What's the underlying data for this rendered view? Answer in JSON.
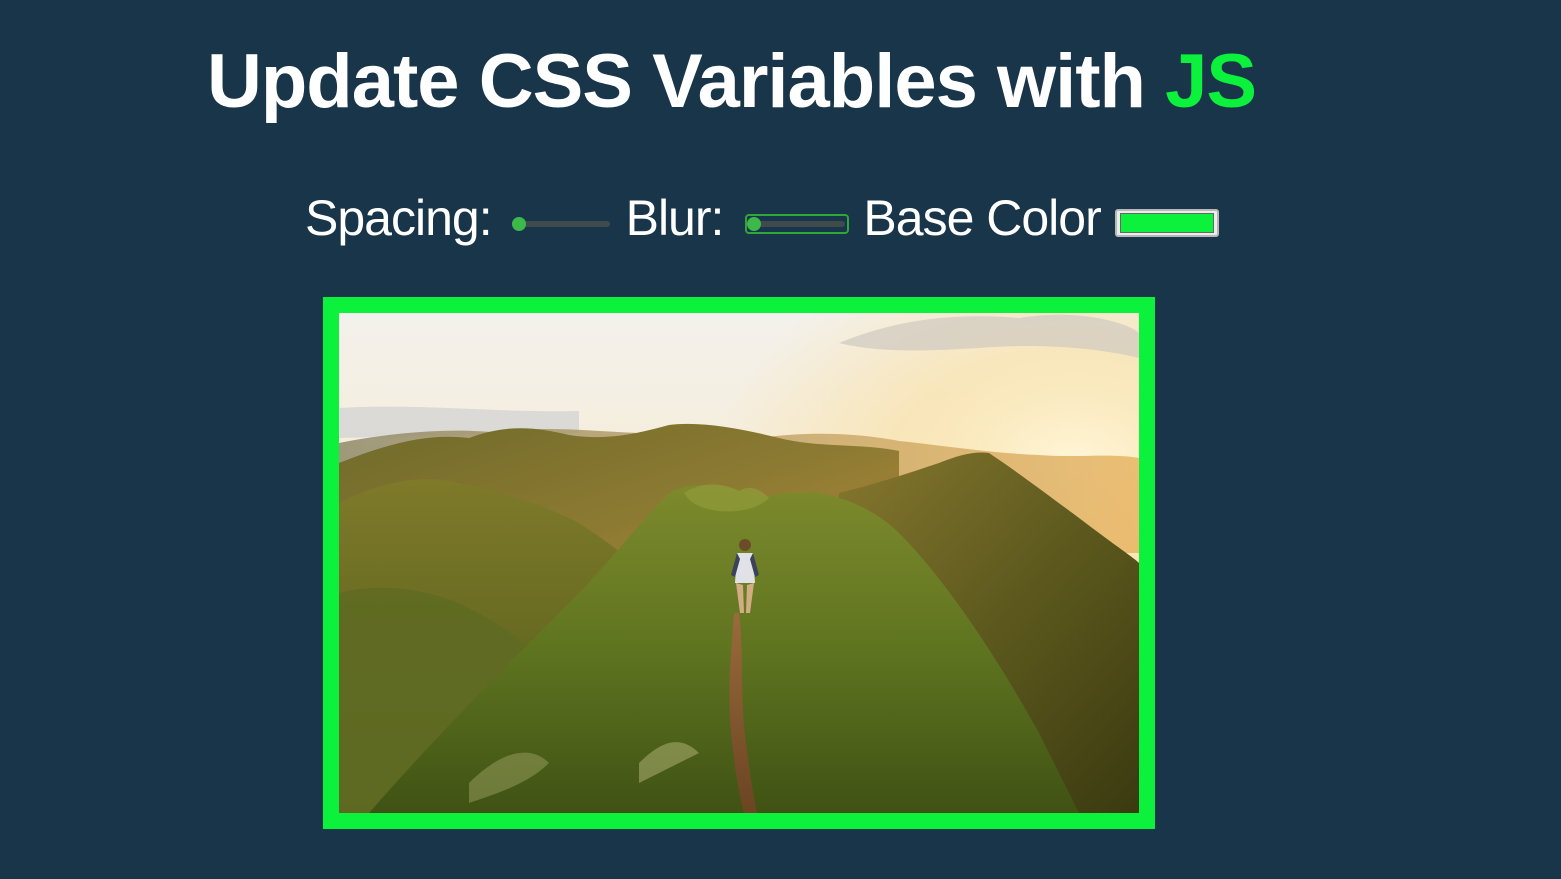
{
  "title": {
    "main": "Update CSS Variables with ",
    "highlight": "JS"
  },
  "controls": {
    "spacing_label": "Spacing:",
    "spacing_value": 10,
    "spacing_min": 10,
    "spacing_max": 200,
    "blur_label": "Blur:",
    "blur_value": 0,
    "blur_min": 0,
    "blur_max": 25,
    "base_color_label": "Base Color",
    "base_color_value": "#0cf13c"
  },
  "colors": {
    "background": "#193549",
    "accent": "#0cf13c",
    "text": "#ffffff",
    "slider_thumb": "#3cb94a"
  },
  "photo": {
    "subject": "hiker-on-mountain-ridge-at-sunset"
  }
}
